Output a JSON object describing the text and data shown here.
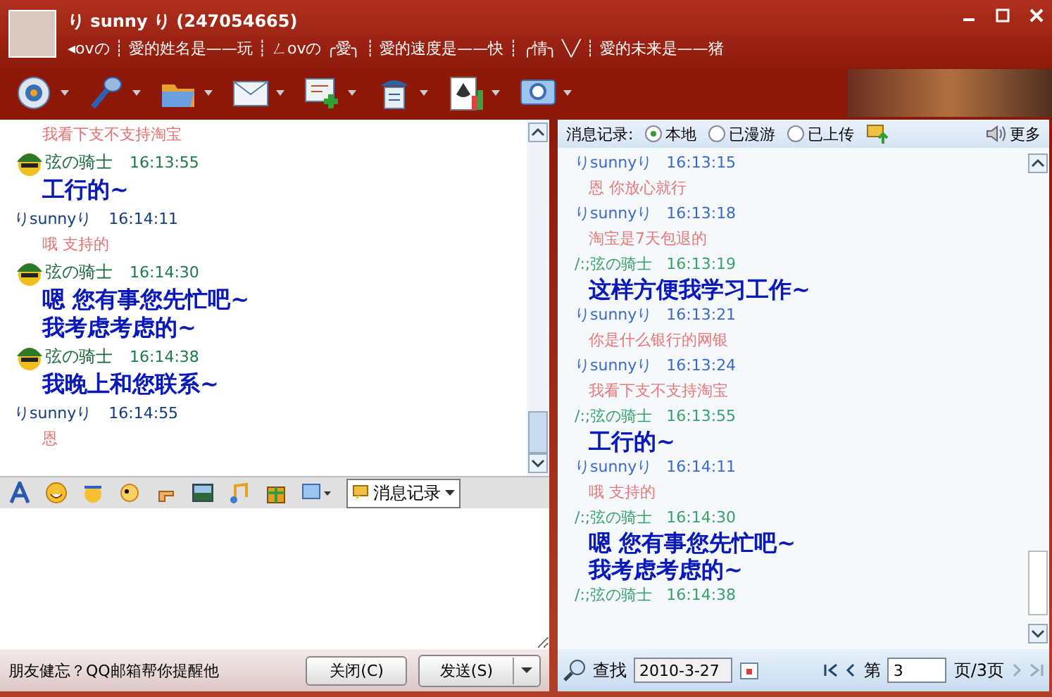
{
  "window": {
    "name": "り sunny り (247054665)",
    "signature": "◂ovの ┊ 愛的姓名是——玩 ┊ ㄥovの ╭愛╮ ┊ 愛的速度是——快 ┊ ╭情╮ ╲╱ ┊ 愛的未来是——猪"
  },
  "chat": {
    "messages": [
      {
        "kind": "me",
        "lines": [
          "我看下支不支持淘宝"
        ]
      },
      {
        "kind": "friend",
        "sender": "弦の骑士",
        "time": "16:13:55",
        "lines": [
          "工行的~"
        ]
      },
      {
        "kind": "me",
        "sender": "りsunnyり",
        "time": "16:14:11",
        "lines": [
          "哦  支持的"
        ]
      },
      {
        "kind": "friend",
        "sender": "弦の骑士",
        "time": "16:14:30",
        "lines": [
          "嗯  您有事您先忙吧~",
          "我考虑考虑的~"
        ]
      },
      {
        "kind": "friend",
        "sender": "弦の骑士",
        "time": "16:14:38",
        "lines": [
          "我晚上和您联系~"
        ]
      },
      {
        "kind": "me",
        "sender": "りsunnyり",
        "time": "16:14:55",
        "lines": [
          "恩"
        ]
      }
    ]
  },
  "input_toolbar": {
    "history_button": "消息记录"
  },
  "footer": {
    "tip": "朋友健忘？QQ邮箱帮你提醒他",
    "close_button": "关闭(C)",
    "send_button": "发送(S)"
  },
  "history": {
    "label": "消息记录:",
    "sources": [
      {
        "label": "本地",
        "selected": true
      },
      {
        "label": "已漫游",
        "selected": false
      },
      {
        "label": "已上传",
        "selected": false
      }
    ],
    "more": "更多",
    "messages": [
      {
        "kind": "me",
        "sender": "りsunnyり",
        "time": "16:13:15",
        "lines": [
          "恩 你放心就行"
        ]
      },
      {
        "kind": "me",
        "sender": "りsunnyり",
        "time": "16:13:18",
        "lines": [
          "淘宝是7天包退的"
        ]
      },
      {
        "kind": "friend",
        "sender": "/:;弦の骑士",
        "time": "16:13:19",
        "lines": [
          "这样方便我学习工作~"
        ]
      },
      {
        "kind": "me",
        "sender": "りsunnyり",
        "time": "16:13:21",
        "lines": [
          "你是什么银行的网银"
        ]
      },
      {
        "kind": "me",
        "sender": "りsunnyり",
        "time": "16:13:24",
        "lines": [
          "我看下支不支持淘宝"
        ]
      },
      {
        "kind": "friend",
        "sender": "/:;弦の骑士",
        "time": "16:13:55",
        "lines": [
          "工行的~"
        ]
      },
      {
        "kind": "me",
        "sender": "りsunnyり",
        "time": "16:14:11",
        "lines": [
          "哦 支持的"
        ]
      },
      {
        "kind": "friend",
        "sender": "/:;弦の骑士",
        "time": "16:14:30",
        "lines": [
          "嗯  您有事您先忙吧~",
          "我考虑考虑的~"
        ]
      },
      {
        "kind": "friend",
        "sender": "/:;弦の骑士",
        "time": "16:14:38"
      }
    ],
    "search": {
      "label": "查找",
      "date": "2010-3-27"
    },
    "pager": {
      "prefix": "第",
      "page": "3",
      "suffix": "页/3页"
    }
  }
}
